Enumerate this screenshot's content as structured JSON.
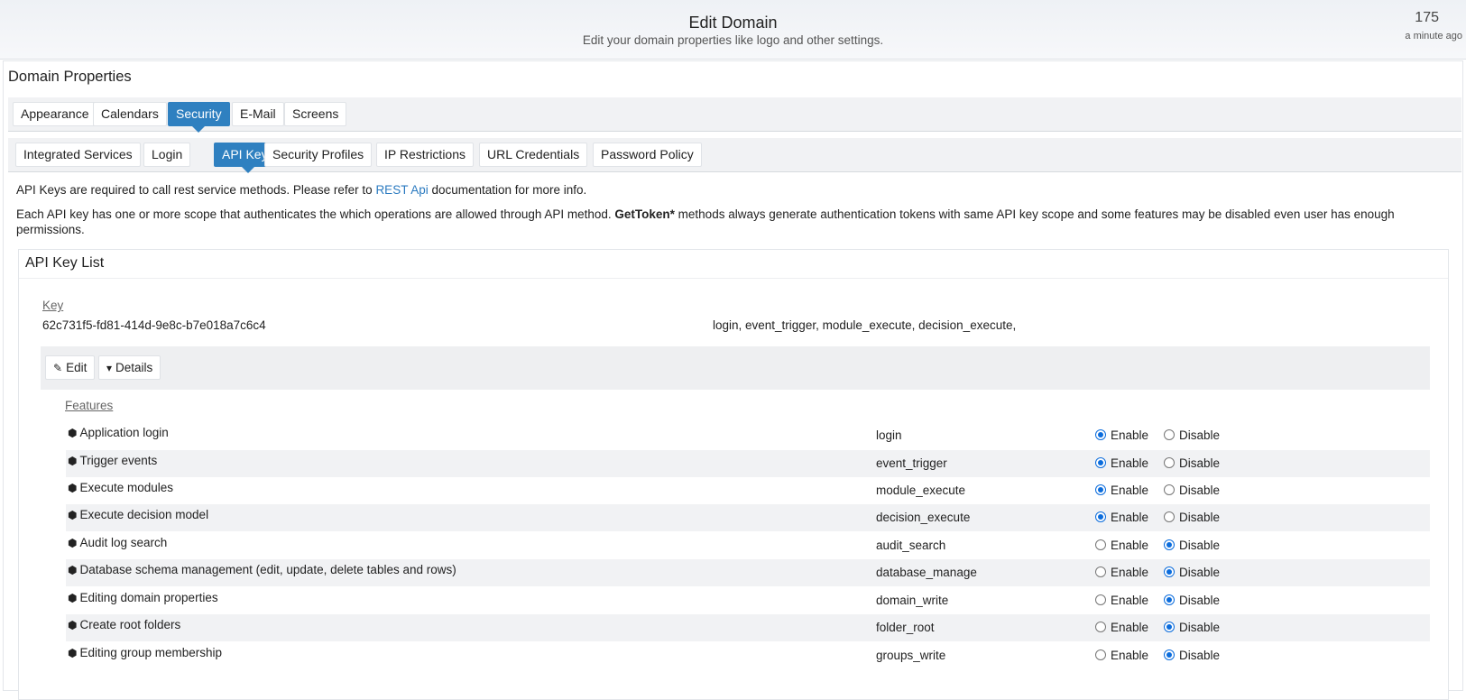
{
  "header": {
    "title": "Edit Domain",
    "subtitle": "Edit your domain properties like logo and other settings.",
    "counter": "175",
    "counter_time": "a minute ago"
  },
  "panel": {
    "title": "Domain Properties"
  },
  "tabs_primary": [
    {
      "label": "Appearance",
      "active": false
    },
    {
      "label": "Calendars",
      "active": false
    },
    {
      "label": "Security",
      "active": true
    },
    {
      "label": "E-Mail",
      "active": false
    },
    {
      "label": "Screens",
      "active": false
    }
  ],
  "tabs_secondary": [
    {
      "label": "Integrated Services",
      "active": false
    },
    {
      "label": "Login",
      "active": false
    },
    {
      "label": "API Keys",
      "active": true
    },
    {
      "label": "Security Profiles",
      "active": false
    },
    {
      "label": "IP Restrictions",
      "active": false
    },
    {
      "label": "URL Credentials",
      "active": false
    },
    {
      "label": "Password Policy",
      "active": false
    }
  ],
  "intro": {
    "p1_before": "API Keys are required to call rest service methods. Please refer to ",
    "p1_link": "REST Api",
    "p1_after": " documentation for more info.",
    "p2_before": "Each API key has one or more scope that authenticates the which operations are allowed through API method. ",
    "p2_bold": "GetToken*",
    "p2_after": " methods always generate authentication tokens with same API key scope and some features may be disabled even user has enough permissions."
  },
  "keylist": {
    "title": "API Key List",
    "key_label": "Key",
    "key_value": "62c731f5-fd81-414d-9e8c-b7e018a7c6c4",
    "scopes": "login, event_trigger, module_execute, decision_execute,",
    "edit_label": "Edit",
    "details_label": "Details",
    "features_label": "Features",
    "enable_label": "Enable",
    "disable_label": "Disable"
  },
  "features": [
    {
      "name": "Application login",
      "code": "login",
      "enabled": true
    },
    {
      "name": "Trigger events",
      "code": "event_trigger",
      "enabled": true
    },
    {
      "name": "Execute modules",
      "code": "module_execute",
      "enabled": true
    },
    {
      "name": "Execute decision model",
      "code": "decision_execute",
      "enabled": true
    },
    {
      "name": "Audit log search",
      "code": "audit_search",
      "enabled": false
    },
    {
      "name": "Database schema management (edit, update, delete tables and rows)",
      "code": "database_manage",
      "enabled": false
    },
    {
      "name": "Editing domain properties",
      "code": "domain_write",
      "enabled": false
    },
    {
      "name": "Create root folders",
      "code": "folder_root",
      "enabled": false
    },
    {
      "name": "Editing group membership",
      "code": "groups_write",
      "enabled": false
    }
  ],
  "colors": {
    "accent": "#2f80c0",
    "link": "#2a7ac0",
    "radio": "#0b6cdc"
  }
}
